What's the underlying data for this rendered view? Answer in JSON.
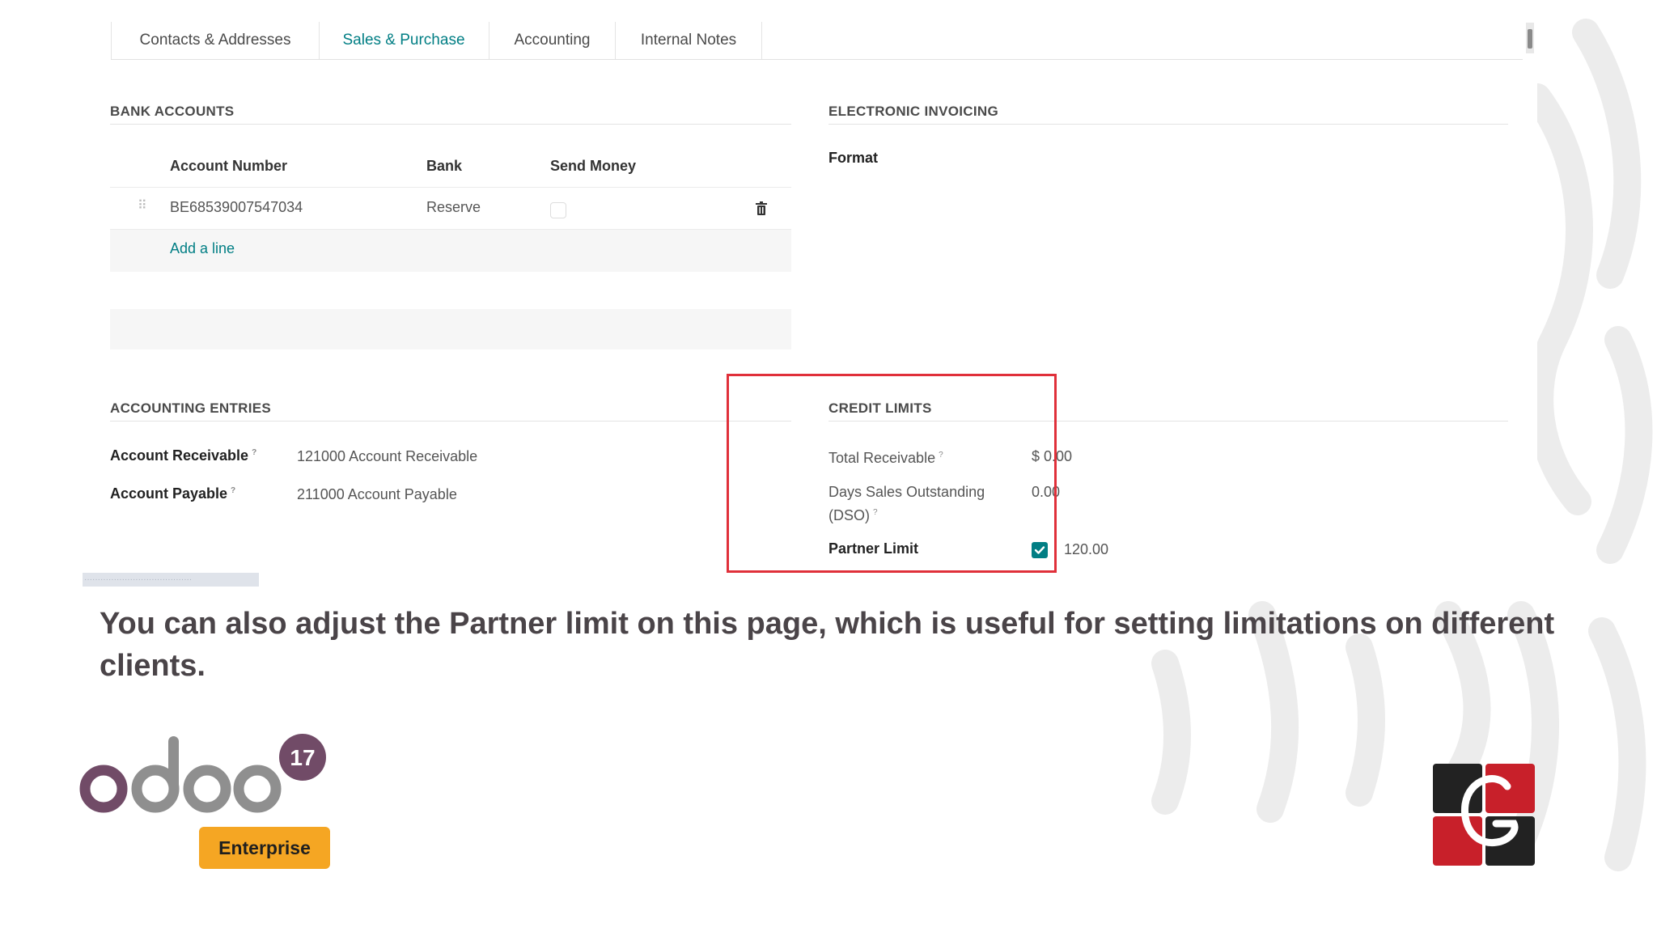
{
  "tabs": [
    {
      "label": "Contacts & Addresses"
    },
    {
      "label": "Sales & Purchase"
    },
    {
      "label": "Accounting"
    },
    {
      "label": "Internal Notes"
    }
  ],
  "bank_accounts": {
    "title": "BANK ACCOUNTS",
    "columns": [
      "Account Number",
      "Bank",
      "Send Money"
    ],
    "rows": [
      {
        "account_number": "BE68539007547034",
        "bank": "Reserve",
        "send_money": false
      }
    ],
    "add_line": "Add a line"
  },
  "electronic_invoicing": {
    "title": "ELECTRONIC INVOICING",
    "format_label": "Format"
  },
  "accounting_entries": {
    "title": "ACCOUNTING ENTRIES",
    "receivable_label": "Account Receivable",
    "receivable_value": "121000 Account Receivable",
    "payable_label": "Account Payable",
    "payable_value": "211000 Account Payable",
    "help_mark": "?"
  },
  "credit_limits": {
    "title": "CREDIT LIMITS",
    "total_receivable_label": "Total Receivable",
    "total_receivable_value": "$ 0.00",
    "dso_label": "Days Sales Outstanding (DSO)",
    "dso_value": "0.00",
    "partner_limit_label": "Partner Limit",
    "partner_limit_checked": true,
    "partner_limit_value": "120.00",
    "highlight_color": "#e0303a"
  },
  "caption": "You can also adjust the Partner limit on this page, which is useful for setting limitations on different clients.",
  "brand": {
    "version": "17",
    "edition": "Enterprise",
    "accent": "#714b67",
    "badge_color": "#f5a623"
  },
  "colors": {
    "primary_teal": "#017e84"
  }
}
